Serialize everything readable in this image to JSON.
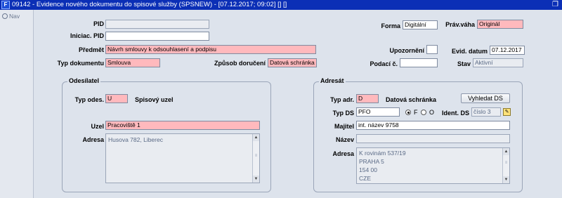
{
  "window": {
    "title": "09142 - Evidence nového dokumentu do spisové služby (SPSNEW) - [07.12.2017; 09:02] [] []",
    "app_icon": "app-icon",
    "restore": "❐"
  },
  "nav": {
    "label": "Nav"
  },
  "header": {
    "pid": {
      "label": "PID",
      "value": ""
    },
    "iniciac_pid": {
      "label": "Iniciac. PID",
      "value": ""
    },
    "predmet": {
      "label": "Předmět",
      "value": "Návrh smlouvy k odsouhlasení a podpisu"
    },
    "typ_dokumentu": {
      "label": "Typ dokumentu",
      "value": "Smlouva"
    },
    "zpusob_doruceni": {
      "label": "Způsob doručení",
      "value": "Datová schránka"
    },
    "forma": {
      "label": "Forma",
      "value": "Digitální"
    },
    "prav_vaha": {
      "label": "Práv.váha",
      "value": "Originál"
    },
    "upozorneni": {
      "label": "Upozornění",
      "value": ""
    },
    "evid_datum": {
      "label": "Evid. datum",
      "value": "07.12.2017"
    },
    "podaci_c": {
      "label": "Podací č.",
      "value": ""
    },
    "stav": {
      "label": "Stav",
      "value": "Aktivní"
    }
  },
  "odesilatel": {
    "title": "Odesílatel",
    "typ_odes": {
      "label": "Typ odes.",
      "value": "U",
      "desc": "Spisový uzel"
    },
    "uzel": {
      "label": "Uzel",
      "value": "Pracoviště 1"
    },
    "adresa": {
      "label": "Adresa",
      "value": "Husova 782, Liberec"
    }
  },
  "adresat": {
    "title": "Adresát",
    "typ_adr": {
      "label": "Typ adr.",
      "value": "D",
      "desc": "Datová schránka"
    },
    "vyhledat_button": "Vyhledat DS",
    "typ_ds": {
      "label": "Typ DS",
      "value": "PFO",
      "opt_f": "F",
      "opt_o": "O"
    },
    "ident_ds": {
      "label": "Ident. DS",
      "value": "číslo 3"
    },
    "majitel": {
      "label": "Majitel",
      "value": "int. název 9758"
    },
    "nazev": {
      "label": "Název",
      "value": ""
    },
    "adresa": {
      "label": "Adresa",
      "lines": [
        "K rovinám 537/19",
        "PRAHA 5",
        "154 00",
        "CZE"
      ]
    }
  },
  "colors": {
    "titlebar": "#0b2fb6",
    "required": "#ffb9bd",
    "background": "#dde3ec"
  }
}
